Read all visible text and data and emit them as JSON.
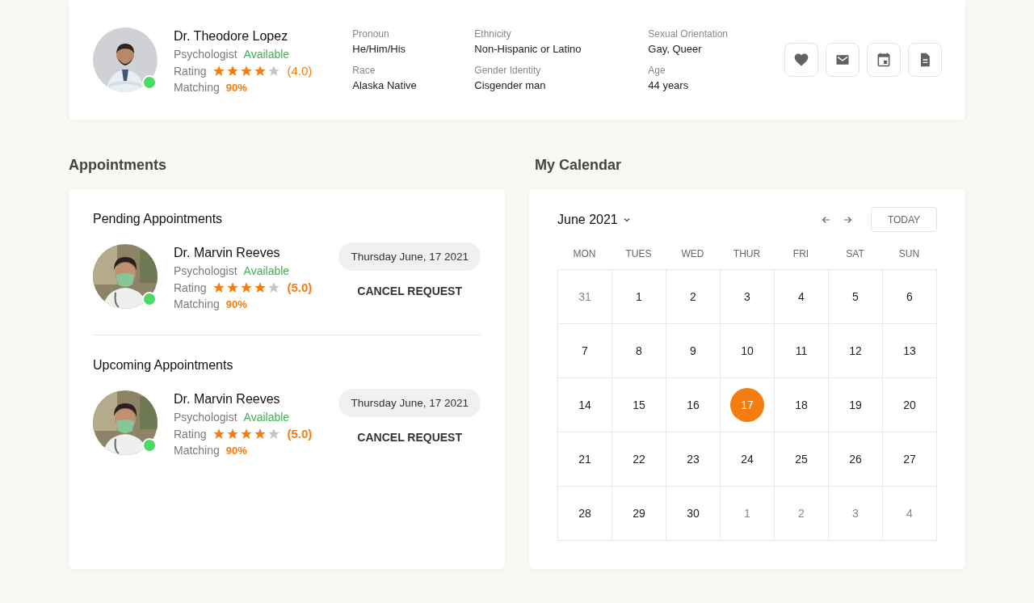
{
  "profile": {
    "name": "Dr. Theodore Lopez",
    "role": "Psychologist",
    "status": "Available",
    "online": true,
    "rating_label": "Rating",
    "stars": 4,
    "rating": "(4.0)",
    "matching_label": "Matching",
    "matching": "90%",
    "details": [
      {
        "label": "Pronoun",
        "value": "He/Him/His"
      },
      {
        "label": "Race",
        "value": "Alaska Native"
      },
      {
        "label": "Ethnicity",
        "value": "Non-Hispanic or Latino"
      },
      {
        "label": "Gender Identity",
        "value": "Cisgender man"
      },
      {
        "label": "Sexual Orientation",
        "value": "Gay, Queer"
      },
      {
        "label": "Age",
        "value": "44 years"
      }
    ],
    "actions": [
      {
        "kind": "heart"
      },
      {
        "kind": "mail"
      },
      {
        "kind": "calendar"
      },
      {
        "kind": "document"
      }
    ]
  },
  "appointments": {
    "title": "Appointments",
    "sections": [
      {
        "title": "Pending Appointments",
        "doctor": {
          "name": "Dr. Marvin Reeves",
          "role": "Psychologist",
          "status": "Available",
          "online": true,
          "rating_label": "Rating",
          "stars": 4,
          "rating": "(5.0)",
          "matching_label": "Matching",
          "matching": "90%"
        },
        "date": "Thursday June, 17 2021",
        "action": "CANCEL REQUEST"
      },
      {
        "title": "Upcoming Appointments",
        "doctor": {
          "name": "Dr. Marvin Reeves",
          "role": "Psychologist",
          "status": "Available",
          "online": true,
          "rating_label": "Rating",
          "stars": 4,
          "rating": "(5.0)",
          "matching_label": "Matching",
          "matching": "90%"
        },
        "date": "Thursday June, 17 2021",
        "action": "CANCEL REQUEST"
      }
    ]
  },
  "calendar": {
    "title": "My Calendar",
    "month": "June 2021",
    "today_button": "TODAY",
    "weekdays": [
      "MON",
      "TUES",
      "WED",
      "THUR",
      "FRI",
      "SAT",
      "SUN"
    ],
    "days": [
      {
        "label": "31",
        "muted": true,
        "selected": false
      },
      {
        "label": "1",
        "muted": false,
        "selected": false
      },
      {
        "label": "2",
        "muted": false,
        "selected": false
      },
      {
        "label": "3",
        "muted": false,
        "selected": false
      },
      {
        "label": "4",
        "muted": false,
        "selected": false
      },
      {
        "label": "5",
        "muted": false,
        "selected": false
      },
      {
        "label": "6",
        "muted": false,
        "selected": false
      },
      {
        "label": "7",
        "muted": false,
        "selected": false
      },
      {
        "label": "8",
        "muted": false,
        "selected": false
      },
      {
        "label": "9",
        "muted": false,
        "selected": false
      },
      {
        "label": "10",
        "muted": false,
        "selected": false
      },
      {
        "label": "11",
        "muted": false,
        "selected": false
      },
      {
        "label": "12",
        "muted": false,
        "selected": false
      },
      {
        "label": "13",
        "muted": false,
        "selected": false
      },
      {
        "label": "14",
        "muted": false,
        "selected": false
      },
      {
        "label": "15",
        "muted": false,
        "selected": false
      },
      {
        "label": "16",
        "muted": false,
        "selected": false
      },
      {
        "label": "17",
        "muted": false,
        "selected": true
      },
      {
        "label": "18",
        "muted": false,
        "selected": false
      },
      {
        "label": "19",
        "muted": false,
        "selected": false
      },
      {
        "label": "20",
        "muted": false,
        "selected": false
      },
      {
        "label": "21",
        "muted": false,
        "selected": false
      },
      {
        "label": "22",
        "muted": false,
        "selected": false
      },
      {
        "label": "23",
        "muted": false,
        "selected": false
      },
      {
        "label": "24",
        "muted": false,
        "selected": false
      },
      {
        "label": "25",
        "muted": false,
        "selected": false
      },
      {
        "label": "26",
        "muted": false,
        "selected": false
      },
      {
        "label": "27",
        "muted": false,
        "selected": false
      },
      {
        "label": "28",
        "muted": false,
        "selected": false
      },
      {
        "label": "29",
        "muted": false,
        "selected": false
      },
      {
        "label": "30",
        "muted": false,
        "selected": false
      },
      {
        "label": "1",
        "muted": true,
        "selected": false
      },
      {
        "label": "2",
        "muted": true,
        "selected": false
      },
      {
        "label": "3",
        "muted": true,
        "selected": false
      },
      {
        "label": "4",
        "muted": true,
        "selected": false
      }
    ]
  }
}
